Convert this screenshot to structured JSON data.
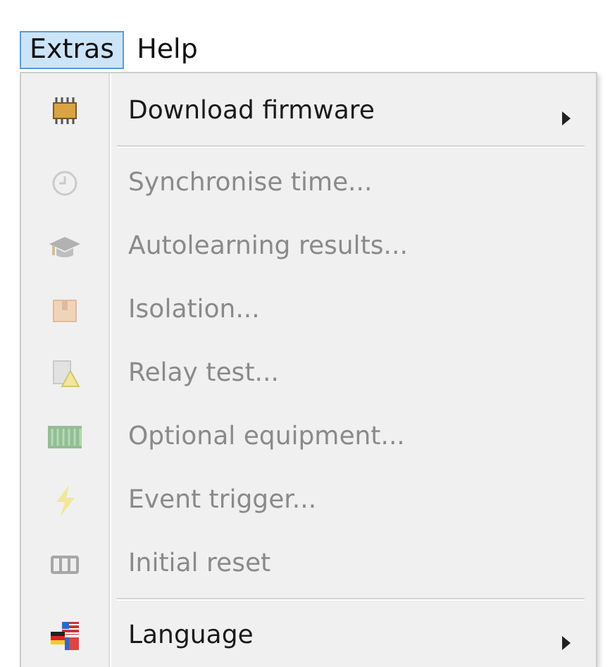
{
  "menubar": [
    {
      "label": "Extras",
      "selected": true
    },
    {
      "label": "Help",
      "selected": false
    }
  ],
  "menu": [
    {
      "kind": "item",
      "label": "Download firmware",
      "disabled": false,
      "submenu": true
    },
    {
      "kind": "separator"
    },
    {
      "kind": "item",
      "label": "Synchronise time...",
      "disabled": true,
      "submenu": false
    },
    {
      "kind": "item",
      "label": "Autolearning results...",
      "disabled": true,
      "submenu": false
    },
    {
      "kind": "item",
      "label": "Isolation...",
      "disabled": true,
      "submenu": false
    },
    {
      "kind": "item",
      "label": "Relay test...",
      "disabled": true,
      "submenu": false
    },
    {
      "kind": "item",
      "label": "Optional equipment...",
      "disabled": true,
      "submenu": false
    },
    {
      "kind": "item",
      "label": "Event trigger...",
      "disabled": true,
      "submenu": false
    },
    {
      "kind": "item",
      "label": "Initial reset",
      "disabled": true,
      "submenu": false
    },
    {
      "kind": "separator"
    },
    {
      "kind": "item",
      "label": "Language",
      "disabled": false,
      "submenu": true
    }
  ]
}
